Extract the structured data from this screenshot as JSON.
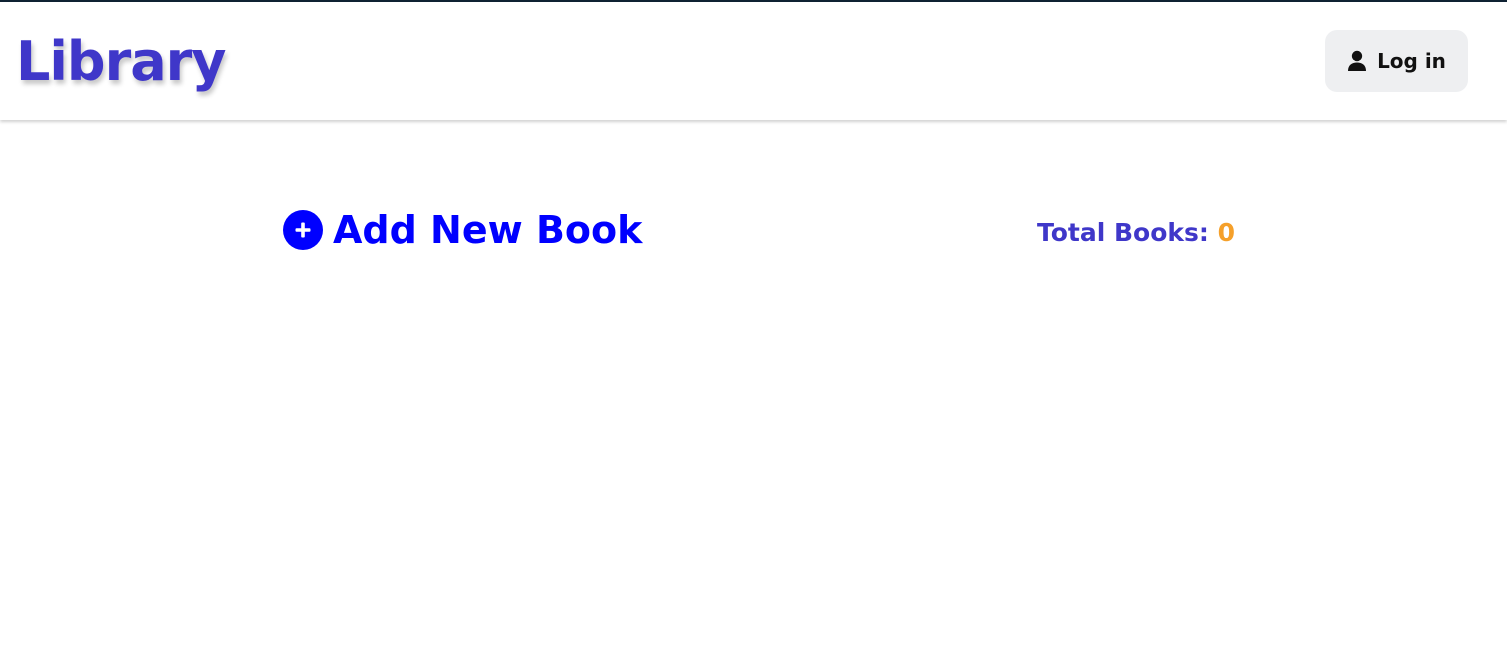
{
  "header": {
    "title": "Library",
    "login_label": "Log in"
  },
  "main": {
    "add_book_label": "Add New Book",
    "total_books_label": "Total Books:",
    "total_books_count": "0"
  },
  "icons": {
    "login": "user-icon",
    "add": "plus-circle-icon"
  },
  "colors": {
    "title": "#3f37c9",
    "add_link": "#0000ff",
    "count": "#f5a02a",
    "login_bg": "#eeeff1"
  }
}
